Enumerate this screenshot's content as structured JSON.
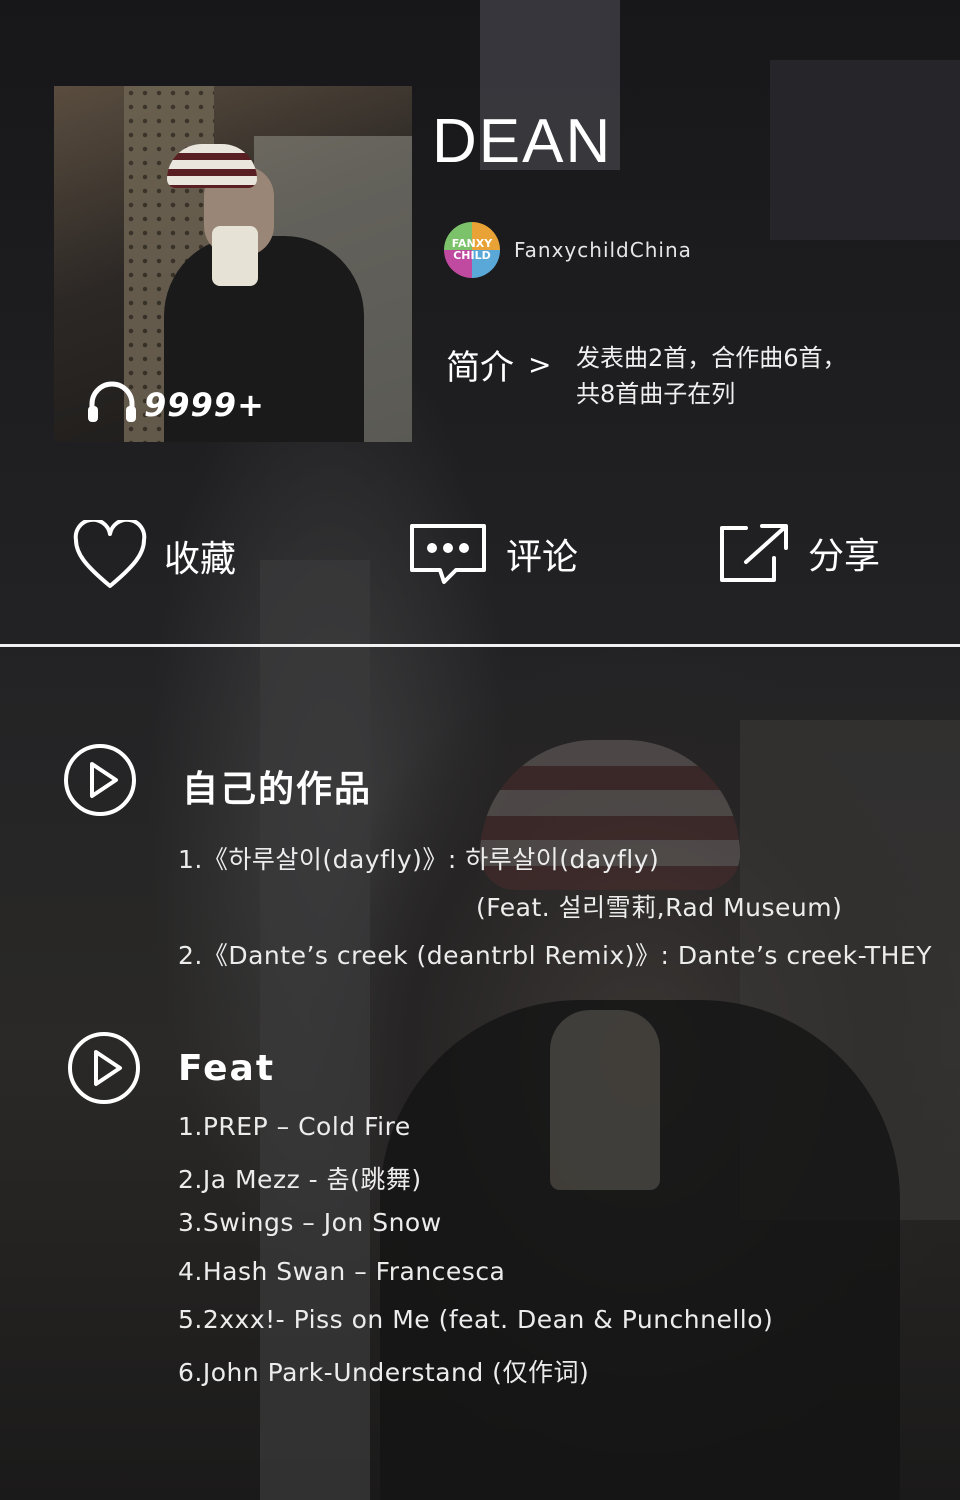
{
  "header": {
    "artist_name": "DEAN",
    "uploader_name": "FanxychildChina",
    "uploader_avatar_text": "FANXY CHILD",
    "play_count": "9999+",
    "intro_label": "简介",
    "intro_chevron": ">",
    "intro_text_line1": "发表曲2首，合作曲6首，",
    "intro_text_line2": "共8首曲子在列"
  },
  "actions": {
    "favorite_label": "收藏",
    "comment_label": "评论",
    "share_label": "分享"
  },
  "sections": {
    "own_works": {
      "title": "自己的作品",
      "tracks": [
        "1.《하루살이(dayfly)》: 하루살이(dayfly)",
        "(Feat. 설리雪莉,Rad Museum)",
        "2.《Dante’s creek (deantrbl Remix)》: Dante’s creek-THEY"
      ]
    },
    "feat": {
      "title": "Feat",
      "tracks": [
        "1.PREP – Cold Fire",
        "2.Ja Mezz - 춤(跳舞)",
        "3.Swings – Jon Snow",
        "4.Hash Swan – Francesca",
        "5.2xxx!- Piss on Me (feat. Dean & Punchnello)",
        "6.John Park-Understand (仅作词)"
      ]
    }
  },
  "icons": {
    "headphones": "headphones-icon",
    "heart": "heart-icon",
    "comment": "comment-icon",
    "share": "share-icon",
    "play": "play-circle-icon"
  },
  "colors": {
    "text": "#f2f2f2",
    "background": "#1e1e20",
    "divider": "#f2f2f2"
  }
}
